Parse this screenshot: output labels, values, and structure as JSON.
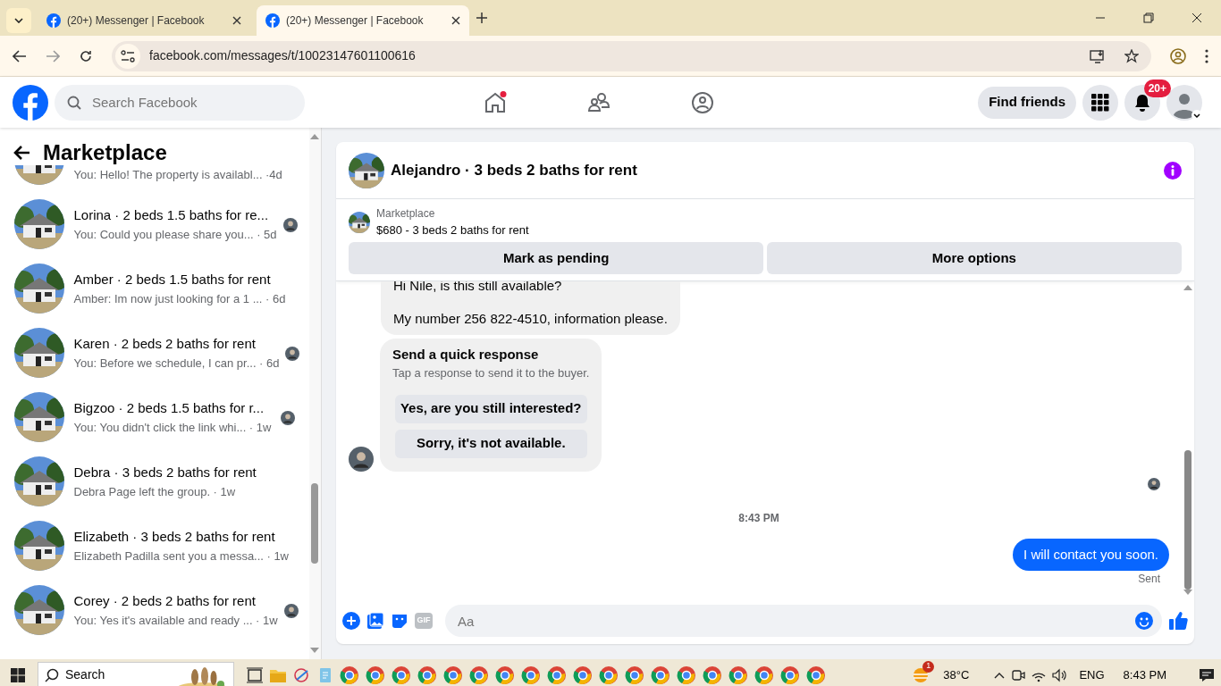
{
  "browser": {
    "tabs": [
      {
        "title": "(20+) Messenger | Facebook",
        "selected": false
      },
      {
        "title": "(20+) Messenger | Facebook",
        "selected": true
      }
    ],
    "url": "facebook.com/messages/t/10023147601100616"
  },
  "header": {
    "search_placeholder": "Search Facebook",
    "find_friends": "Find friends",
    "notification_badge": "20+"
  },
  "sidebar": {
    "title": "Marketplace",
    "conversations": [
      {
        "kind": "clipped",
        "preview": "You: Hello! The property is availabl...",
        "time": "·4d",
        "seen": false
      },
      {
        "kind": "full",
        "title": "Lorina · 2 beds 1.5 baths for re...",
        "preview": "You: Could you please share you...",
        "time": "· 5d",
        "seen": true
      },
      {
        "kind": "full",
        "title": "Amber · 2 beds 1.5 baths for rent",
        "preview": "Amber: Im now just looking for a 1 ...",
        "time": "· 6d",
        "seen": false
      },
      {
        "kind": "full",
        "title": "Karen · 2 beds 2 baths for rent",
        "preview": "You: Before we schedule, I can pr...",
        "time": "· 6d",
        "seen": true
      },
      {
        "kind": "full",
        "title": "Bigzoo · 2 beds 1.5 baths for r...",
        "preview": "You: You didn't click the link whi...",
        "time": "· 1w",
        "seen": true
      },
      {
        "kind": "full",
        "title": "Debra · 3 beds 2 baths for rent",
        "preview": "Debra Page left the group.",
        "time": "· 1w",
        "seen": false
      },
      {
        "kind": "full",
        "title": "Elizabeth · 3 beds 2 baths for rent",
        "preview": "Elizabeth Padilla sent you a messa...",
        "time": "· 1w",
        "seen": false
      },
      {
        "kind": "full",
        "title": "Corey · 2 beds 2 baths for rent",
        "preview": "You: Yes it's available and ready ...",
        "time": "· 1w",
        "seen": true
      }
    ]
  },
  "chat": {
    "title": "Alejandro · 3 beds 2 baths for rent",
    "listing": {
      "label": "Marketplace",
      "text": "$680 - 3 beds 2 baths for rent"
    },
    "actions": [
      "Mark as pending",
      "More options"
    ],
    "incoming": [
      "Hi Nile, is this still available?",
      "My number 256 822-4510, information please."
    ],
    "quick_response": {
      "title": "Send a quick response",
      "subtitle": "Tap a response to send it to the buyer.",
      "options": [
        "Yes, are you still interested?",
        "Sorry, it's not available."
      ]
    },
    "timestamp": "8:43 PM",
    "outgoing": {
      "text": "I will contact you soon.",
      "status": "Sent"
    },
    "composer": {
      "placeholder": "Aa",
      "gif_label": "GIF"
    }
  },
  "taskbar": {
    "search": "Search",
    "weather_badge": "1",
    "temperature": "38°C",
    "language": "ENG",
    "time": "8:43 PM"
  }
}
